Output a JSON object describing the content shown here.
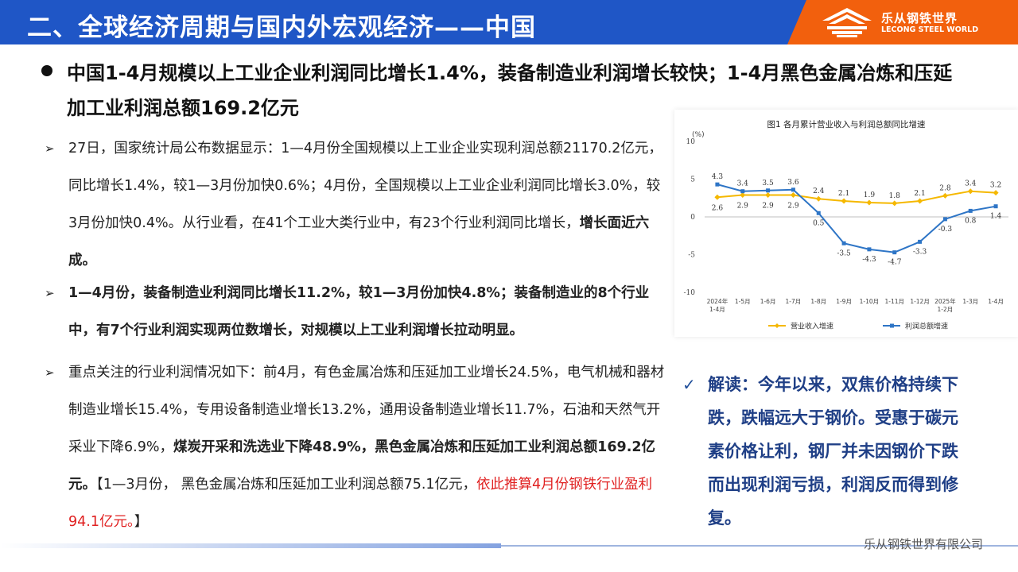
{
  "header": {
    "title": "二、全球经济周期与国内外宏观经济——中国",
    "logo_cn": "乐从钢铁世界",
    "logo_en": "LECONG STEEL WORLD"
  },
  "headline": "中国1-4月规模以上工业企业利润同比增长1.4%，装备制造业利润增长较快；1-4月黑色金属冶炼和压延加工业利润总额169.2亿元",
  "para1": {
    "normal": "27日，国家统计局公布数据显示：1—4月份全国规模以上工业企业实现利润总额21170.2亿元，同比增长1.4%，较1—3月份加快0.6%；4月份，全国规模以上工业企业利润同比增长3.0%，较3月份加快0.4%。从行业看，在41个工业大类行业中，有23个行业利润同比增长，",
    "bold": "增长面近六成。"
  },
  "para2": {
    "bold": "1—4月份，装备制造业利润同比增长11.2%，较1—3月份加快4.8%；装备制造业的8个行业中，有7个行业利润实现两位数增长，对规模以上工业利润增长拉动明显。"
  },
  "para3": {
    "normal1": "重点关注的行业利润情况如下：前4月，有色金属冶炼和压延加工业增长24.5%，电气机械和器材制造业增长15.4%，专用设备制造业增长13.2%，通用设备制造业增长11.7%，石油和天然气开采业下降6.9%，",
    "bold": "煤炭开采和洗选业下降48.9%，黑色金属冶炼和压延加工业利润总额169.2亿元。",
    "normal2": "【1—3月份， 黑色金属冶炼和压延加工业利润总额75.1亿元，",
    "red": "依此推算4月份钢铁行业盈利94.1亿元。",
    "normal3": "】"
  },
  "interpretation": "解读：今年以来，双焦价格持续下跌，跌幅远大于钢价。受惠于碳元素价格让利，钢厂并未因钢价下跌而出现利润亏损，利润反而得到修复。",
  "footer": {
    "company": "乐从钢铁世界有限公司"
  },
  "colors": {
    "header_blue": "#1f56c6",
    "logo_orange": "#f2600d",
    "revenue_series": "#f5b800",
    "profit_series": "#2e75c6",
    "highlight_red": "#e02020"
  },
  "chart_data": {
    "type": "line",
    "title": "图1  各月累计营业收入与利润总额同比增速",
    "ylabel": "(%)",
    "ylim": [
      -10,
      10
    ],
    "yticks": [
      -10,
      -5,
      0,
      5,
      10
    ],
    "categories": [
      [
        "2024年",
        "1-4月"
      ],
      [
        "1-5月"
      ],
      [
        "1-6月"
      ],
      [
        "1-7月"
      ],
      [
        "1-8月"
      ],
      [
        "1-9月"
      ],
      [
        "1-10月"
      ],
      [
        "1-11月"
      ],
      [
        "1-12月"
      ],
      [
        "2025年",
        "1-2月"
      ],
      [
        "1-3月"
      ],
      [
        "1-4月"
      ]
    ],
    "series": [
      {
        "name": "营业收入增速",
        "color": "#f5b800",
        "values": [
          2.6,
          2.9,
          2.9,
          2.9,
          2.4,
          2.1,
          1.9,
          1.8,
          2.1,
          2.8,
          3.4,
          3.2
        ]
      },
      {
        "name": "利润总额增速",
        "color": "#2e75c6",
        "values": [
          4.3,
          3.4,
          3.5,
          3.6,
          0.5,
          -3.5,
          -4.3,
          -4.7,
          -3.3,
          -0.3,
          0.8,
          1.4
        ]
      }
    ],
    "legend": "bottom"
  }
}
